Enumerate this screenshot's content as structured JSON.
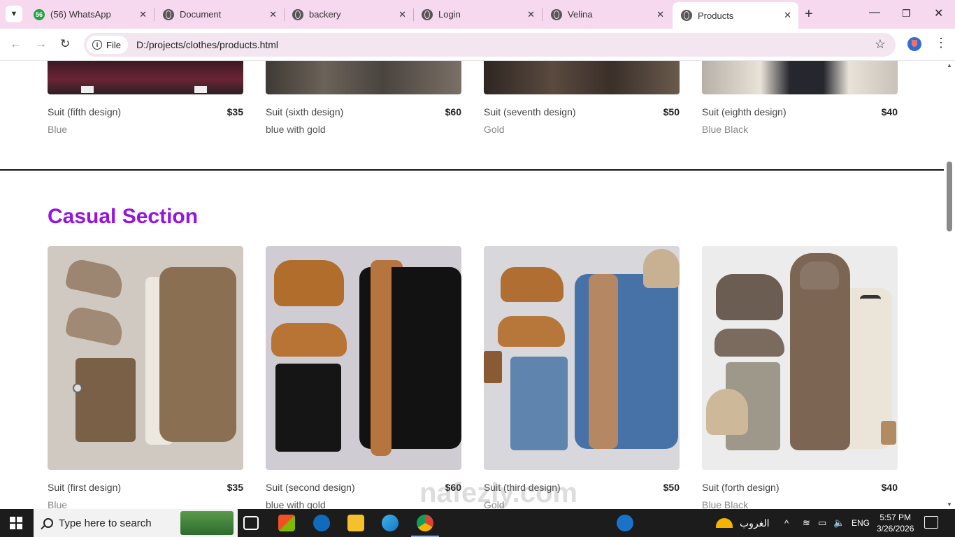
{
  "browser": {
    "tabs": [
      {
        "label": "(56) WhatsApp",
        "badge": "56",
        "icon": "whatsapp-icon",
        "active": false
      },
      {
        "label": "Document",
        "icon": "globe-icon",
        "active": false
      },
      {
        "label": "backery",
        "icon": "globe-icon",
        "active": false
      },
      {
        "label": "Login",
        "icon": "globe-icon",
        "active": false
      },
      {
        "label": "Velina",
        "icon": "globe-icon",
        "active": false
      },
      {
        "label": "Products",
        "icon": "globe-icon",
        "active": true
      }
    ],
    "close_glyph": "✕",
    "new_tab_glyph": "+",
    "address": {
      "chip_label": "File",
      "url": "D:/projects/clothes/products.html"
    }
  },
  "page": {
    "top_products": [
      {
        "name": "Suit (fifth design)",
        "price": "$35",
        "color": "Blue",
        "image": "suit-burgundy"
      },
      {
        "name": "Suit (sixth design)",
        "price": "$60",
        "color": "blue with gold",
        "image": "suit-gray"
      },
      {
        "name": "Suit (seventh design)",
        "price": "$50",
        "color": "Gold",
        "image": "suit-brown"
      },
      {
        "name": "Suit (eighth design)",
        "price": "$40",
        "color": "Blue Black",
        "image": "suit-beige"
      }
    ],
    "casual_section_title": "Casual Section",
    "casual_products": [
      {
        "name": "Suit (first design)",
        "price": "$35",
        "color": "Blue",
        "image": "casual-brown-jacket-outfit"
      },
      {
        "name": "Suit (second design)",
        "price": "$60",
        "color": "blue with gold",
        "image": "casual-black-denim-outfit"
      },
      {
        "name": "Suit (third design)",
        "price": "$50",
        "color": "Gold",
        "image": "casual-blue-denim-outfit"
      },
      {
        "name": "Suit (forth design)",
        "price": "$40",
        "color": "Blue Black",
        "image": "casual-puffer-vest-outfit"
      }
    ],
    "watermark": "nafezly.com"
  },
  "taskbar": {
    "search_placeholder": "Type here to search",
    "weather_label": "الغروب",
    "language": "ENG",
    "time": "5:57 PM",
    "date": "3/26/2026"
  },
  "colors": {
    "tabstrip": "#f6d9ef",
    "section_title": "#9613e0",
    "taskbar": "#1c1c1c"
  }
}
